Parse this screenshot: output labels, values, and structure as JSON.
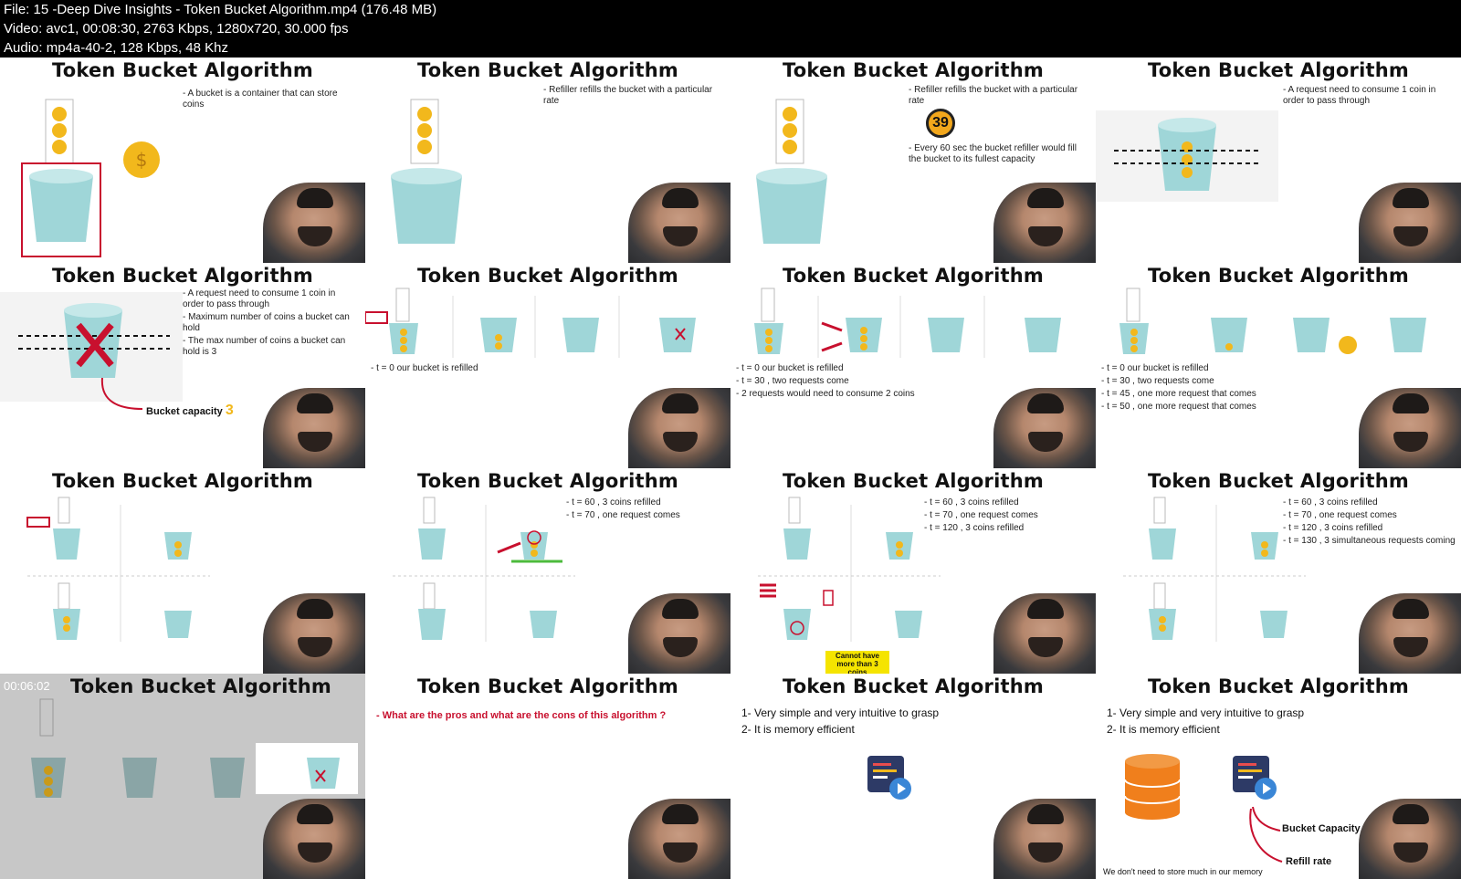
{
  "header": {
    "file": "File: 15 -Deep Dive Insights - Token Bucket Algorithm.mp4 (176.48 MB)",
    "video": "Video: avc1, 00:08:30, 2763 Kbps, 1280x720, 30.000 fps",
    "audio": "Audio: mp4a-40-2, 128 Kbps, 48 Khz"
  },
  "tiles": [
    {
      "title": "Token Bucket Algorithm",
      "bullets": [
        "- A bucket is a container that can store coins"
      ]
    },
    {
      "title": "Token Bucket Algorithm",
      "bullets": [
        "- Refiller refills the bucket with a particular rate"
      ]
    },
    {
      "title": "Token Bucket Algorithm",
      "bullets": [
        "- Refiller refills the bucket with a particular rate",
        "- Every 60 sec the bucket refiller would fill the bucket to its fullest capacity"
      ],
      "counter": "39"
    },
    {
      "title": "Token Bucket Algorithm",
      "bullets": [
        "- A request need to consume 1 coin in order to pass through"
      ]
    },
    {
      "title": "Token Bucket Algorithm",
      "bullets": [
        "- A request need to consume 1 coin in order to pass through",
        "- Maximum number of coins a bucket can hold",
        "- The max number of coins a bucket can hold is 3"
      ],
      "annot": "Bucket capacity",
      "annot_num": "3"
    },
    {
      "title": "Token Bucket Algorithm",
      "bullets": [
        "- t = 0 our bucket is refilled"
      ]
    },
    {
      "title": "Token Bucket Algorithm",
      "bullets": [
        "- t = 0 our bucket is refilled",
        "- t = 30 , two requests come",
        "- 2 requests would need to consume 2 coins"
      ]
    },
    {
      "title": "Token Bucket Algorithm",
      "bullets": [
        "- t = 0 our bucket is refilled",
        "- t = 30 , two requests come",
        "- t = 45 , one more request that comes",
        "- t = 50 , one more request that comes"
      ]
    },
    {
      "title": "Token Bucket Algorithm",
      "bullets": []
    },
    {
      "title": "Token Bucket Algorithm",
      "bullets": [
        "- t = 60 , 3 coins refilled",
        "- t = 70 , one request comes"
      ]
    },
    {
      "title": "Token Bucket Algorithm",
      "bullets": [
        "- t = 60 , 3 coins refilled",
        "- t = 70 , one request comes",
        "- t = 120 , 3 coins refilled"
      ],
      "annot": "Cannot have more than 3 coins"
    },
    {
      "title": "Token Bucket Algorithm",
      "bullets": [
        "- t = 60 , 3 coins refilled",
        "- t = 70 , one request comes",
        "- t = 120 , 3 coins refilled",
        "- t = 130 , 3 simultaneous requests coming"
      ]
    },
    {
      "title": "Token Bucket Algorithm",
      "timestamp": "00:06:02"
    },
    {
      "title": "Token Bucket Algorithm",
      "question": "- What are the pros and what are the cons of this algorithm ?"
    },
    {
      "title": "Token Bucket Algorithm",
      "pros": [
        "1- Very simple and very intuitive to grasp",
        "2- It is memory efficient"
      ]
    },
    {
      "title": "Token Bucket Algorithm",
      "pros": [
        "1- Very simple and very intuitive to grasp",
        "2- It is memory efficient"
      ],
      "annot1": "Bucket Capacity",
      "annot2": "Refill rate",
      "note": "We don't need to store much in our memory"
    }
  ],
  "colors": {
    "bucket": "#9fd6d8",
    "coin": "#f2b81c",
    "red": "#c8102e",
    "arrow_green": "#4cbb3c"
  }
}
